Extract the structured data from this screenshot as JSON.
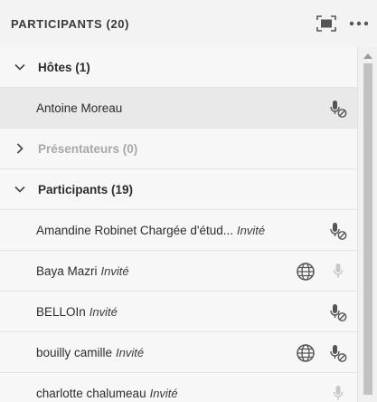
{
  "header": {
    "title": "PARTICIPANTS (20)"
  },
  "sections": {
    "hosts": {
      "label": "Hôtes (1)"
    },
    "presenters": {
      "label": "Présentateurs (0)"
    },
    "participants": {
      "label": "Participants (19)"
    }
  },
  "hosts": [
    {
      "name": "Antoine Moreau",
      "role": ""
    }
  ],
  "participants": [
    {
      "name": "Amandine Robinet Chargée d'étud...",
      "role": "Invité"
    },
    {
      "name": "Baya Mazri",
      "role": "Invité"
    },
    {
      "name": "BELLOIn",
      "role": "Invité"
    },
    {
      "name": "bouilly camille",
      "role": "Invité"
    },
    {
      "name": "charlotte chalumeau",
      "role": "Invité"
    }
  ],
  "icons": {
    "fullscreen": "fullscreen-icon",
    "more": "more-options-icon",
    "mic_muted": "mic-muted-icon",
    "mic_disabled": "mic-disabled-icon",
    "globe": "globe-icon"
  },
  "colors": {
    "panel_bg": "#f7f7f7",
    "selected_bg": "#e9e9e9",
    "muted_text": "#a8a8a8",
    "scroll_thumb": "#c2c2c2"
  }
}
